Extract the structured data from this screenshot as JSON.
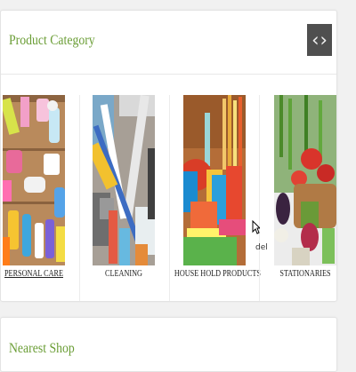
{
  "category": {
    "title": "Product Category",
    "nav": {
      "prev": "‹",
      "next": "›"
    },
    "items": [
      {
        "label": "PERSONAL CARE",
        "image": "personal-care-products-photo"
      },
      {
        "label": "CLEANING",
        "image": "cleaning-supplies-photo"
      },
      {
        "label": "HOUSE HOLD PRODUCTS",
        "image": "household-products-photo"
      },
      {
        "label": "STATIONARIES",
        "image": "vegetables-basket-photo"
      }
    ]
  },
  "cursor_text": "del",
  "nearest": {
    "title": "Nearest Shop"
  },
  "colors": {
    "title": "#6a9d35",
    "nav_bg": "#4f4f4f",
    "background": "#f1f1f1"
  }
}
